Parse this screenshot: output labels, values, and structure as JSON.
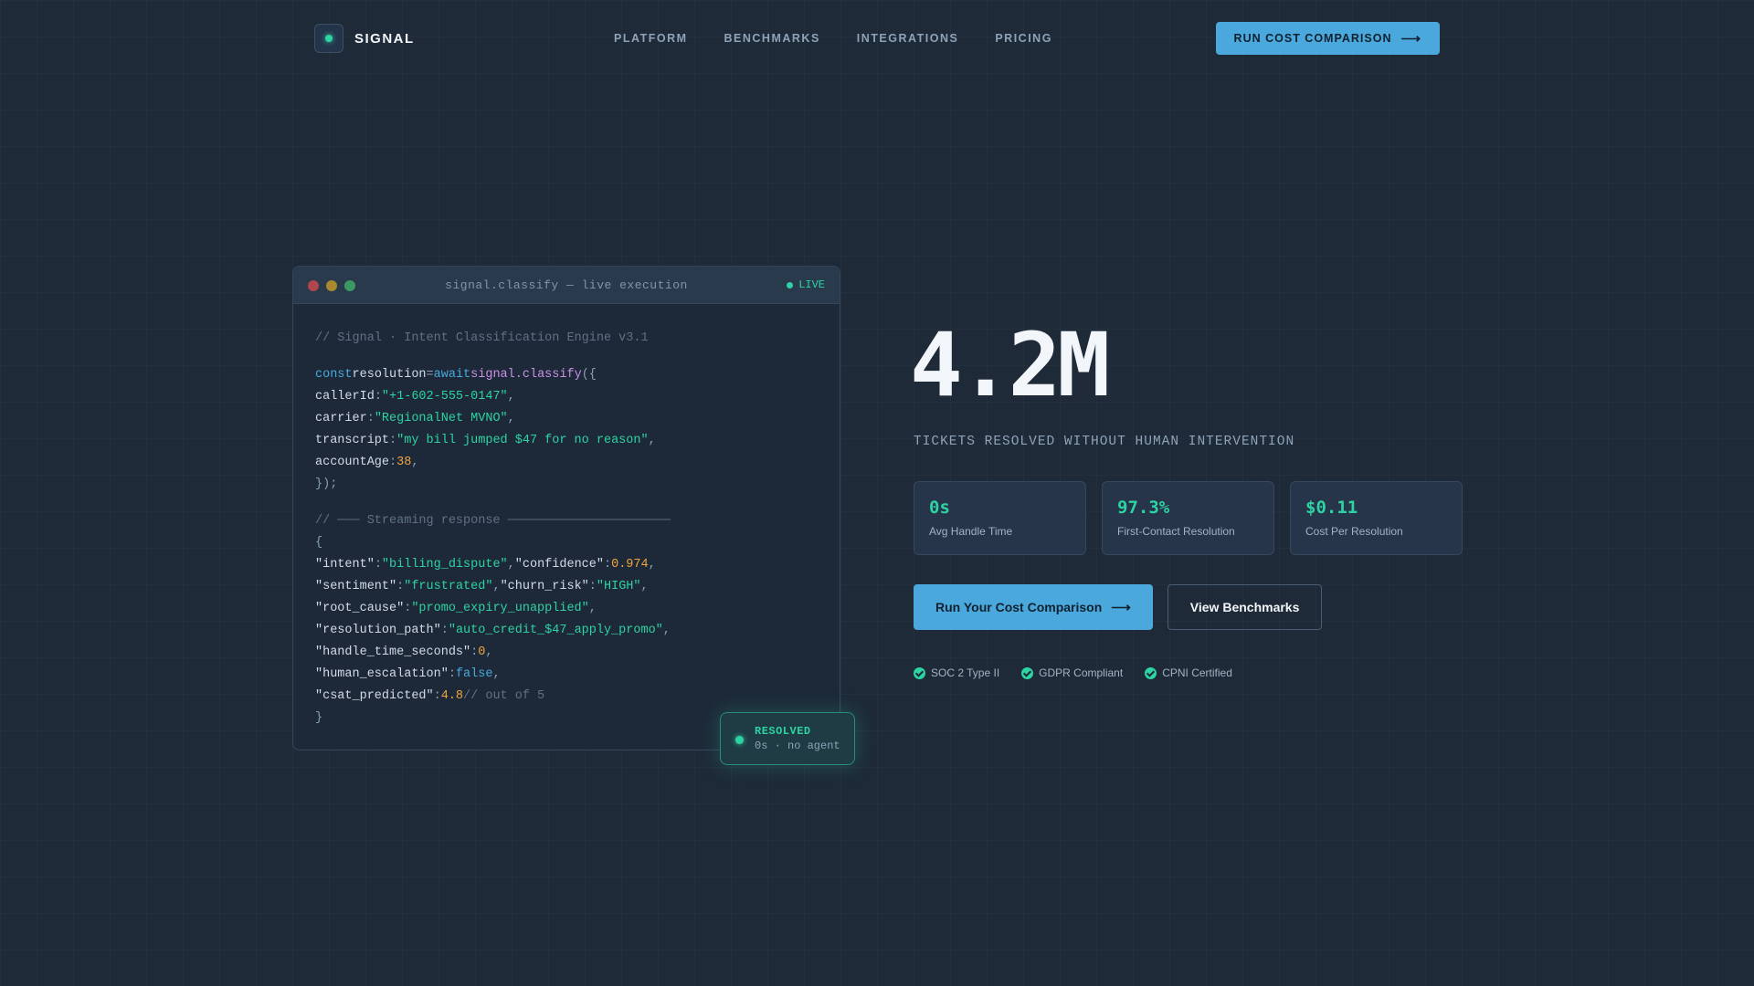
{
  "brand": {
    "name": "SIGNAL"
  },
  "nav": {
    "links": [
      "PLATFORM",
      "BENCHMARKS",
      "INTEGRATIONS",
      "PRICING"
    ],
    "cta_label": "RUN COST COMPARISON"
  },
  "code_window": {
    "title": "signal.classify — live execution",
    "status": "LIVE",
    "header_comment": "// Signal · Intent Classification Engine v3.1",
    "request": {
      "kw_const": "const",
      "var_name": "resolution",
      "eq": "=",
      "kw_await": "await",
      "fn_call": "signal.classify",
      "open": "({",
      "fields": [
        {
          "key": "callerId",
          "value": "\"+1-602-555-0147\"",
          "type": "str"
        },
        {
          "key": "carrier",
          "value": "\"RegionalNet MVNO\"",
          "type": "str"
        },
        {
          "key": "transcript",
          "value": "\"my bill jumped $47 for no reason\"",
          "type": "str"
        },
        {
          "key": "accountAge",
          "value": "38",
          "type": "num"
        }
      ],
      "close": "});"
    },
    "stream_comment": "// ─── Streaming response ──────────────────────",
    "response": {
      "open": "{",
      "close": "}",
      "intent_key": "\"intent\"",
      "intent_val": "\"billing_dispute\"",
      "confidence_key": "\"confidence\"",
      "confidence_val": "0.974",
      "sentiment_key": "\"sentiment\"",
      "sentiment_val": "\"frustrated\"",
      "churn_key": "\"churn_risk\"",
      "churn_val": "\"HIGH\"",
      "root_key": "\"root_cause\"",
      "root_val": "\"promo_expiry_unapplied\"",
      "path_key": "\"resolution_path\"",
      "path_val": "\"auto_credit_$47_apply_promo\"",
      "handle_key": "\"handle_time_seconds\"",
      "handle_val": "0",
      "escalation_key": "\"human_escalation\"",
      "escalation_val": "false",
      "csat_key": "\"csat_predicted\"",
      "csat_val": "4.8",
      "csat_comment": "// out of 5"
    }
  },
  "resolved_badge": {
    "title": "RESOLVED",
    "subtitle": "0s · no agent"
  },
  "hero": {
    "number": "4.2M",
    "subtitle": "TICKETS RESOLVED WITHOUT HUMAN INTERVENTION",
    "stats": [
      {
        "value": "0s",
        "label": "Avg Handle Time"
      },
      {
        "value": "97.3%",
        "label": "First-Contact Resolution"
      },
      {
        "value": "$0.11",
        "label": "Cost Per Resolution"
      }
    ],
    "primary_cta": "Run Your Cost Comparison",
    "secondary_cta": "View Benchmarks",
    "badges": [
      "SOC 2 Type II",
      "GDPR Compliant",
      "CPNI Certified"
    ]
  },
  "colors": {
    "background": "#1e2a38",
    "accent_blue": "#4aa8dc",
    "accent_green": "#2ed3a3",
    "number_orange": "#f0a53e",
    "keyword_purple": "#c990e6"
  }
}
